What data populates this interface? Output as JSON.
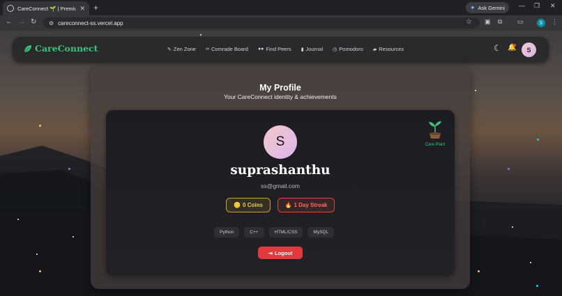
{
  "browser": {
    "tab_title": "CareConnect 🌱 | Premium Ca",
    "url": "careconnect-ss.vercel.app",
    "gemini_label": "Ask Gemini",
    "profile_initial": "S"
  },
  "nav": {
    "brand": "CareConnect",
    "links": [
      {
        "label": "Zen Zone",
        "icon": "brush-icon"
      },
      {
        "label": "Comrade Board",
        "icon": "handshake-icon"
      },
      {
        "label": "Find Peers",
        "icon": "users-icon"
      },
      {
        "label": "Journal",
        "icon": "book-icon"
      },
      {
        "label": "Pomodoro",
        "icon": "clock-icon"
      },
      {
        "label": "Resources",
        "icon": "folder-icon"
      }
    ],
    "avatar_initial": "S"
  },
  "profile": {
    "title": "My Profile",
    "subtitle": "Your CareConnect identity & achievements",
    "avatar_initial": "S",
    "username": "suprashanthu",
    "email": "ss@gmail.com",
    "coins_label": "0 Coins",
    "streak_label": "1 Day Streak",
    "plant_label": "Care Plant",
    "skills": [
      "Python",
      "C++",
      "HTML/CSS",
      "MySQL"
    ],
    "logout_label": "Logout"
  },
  "colors": {
    "brand_green": "#3ec27a",
    "coins_gold": "#f2c94c",
    "streak_red": "#ff6b5e",
    "logout_red": "#e0393e"
  }
}
